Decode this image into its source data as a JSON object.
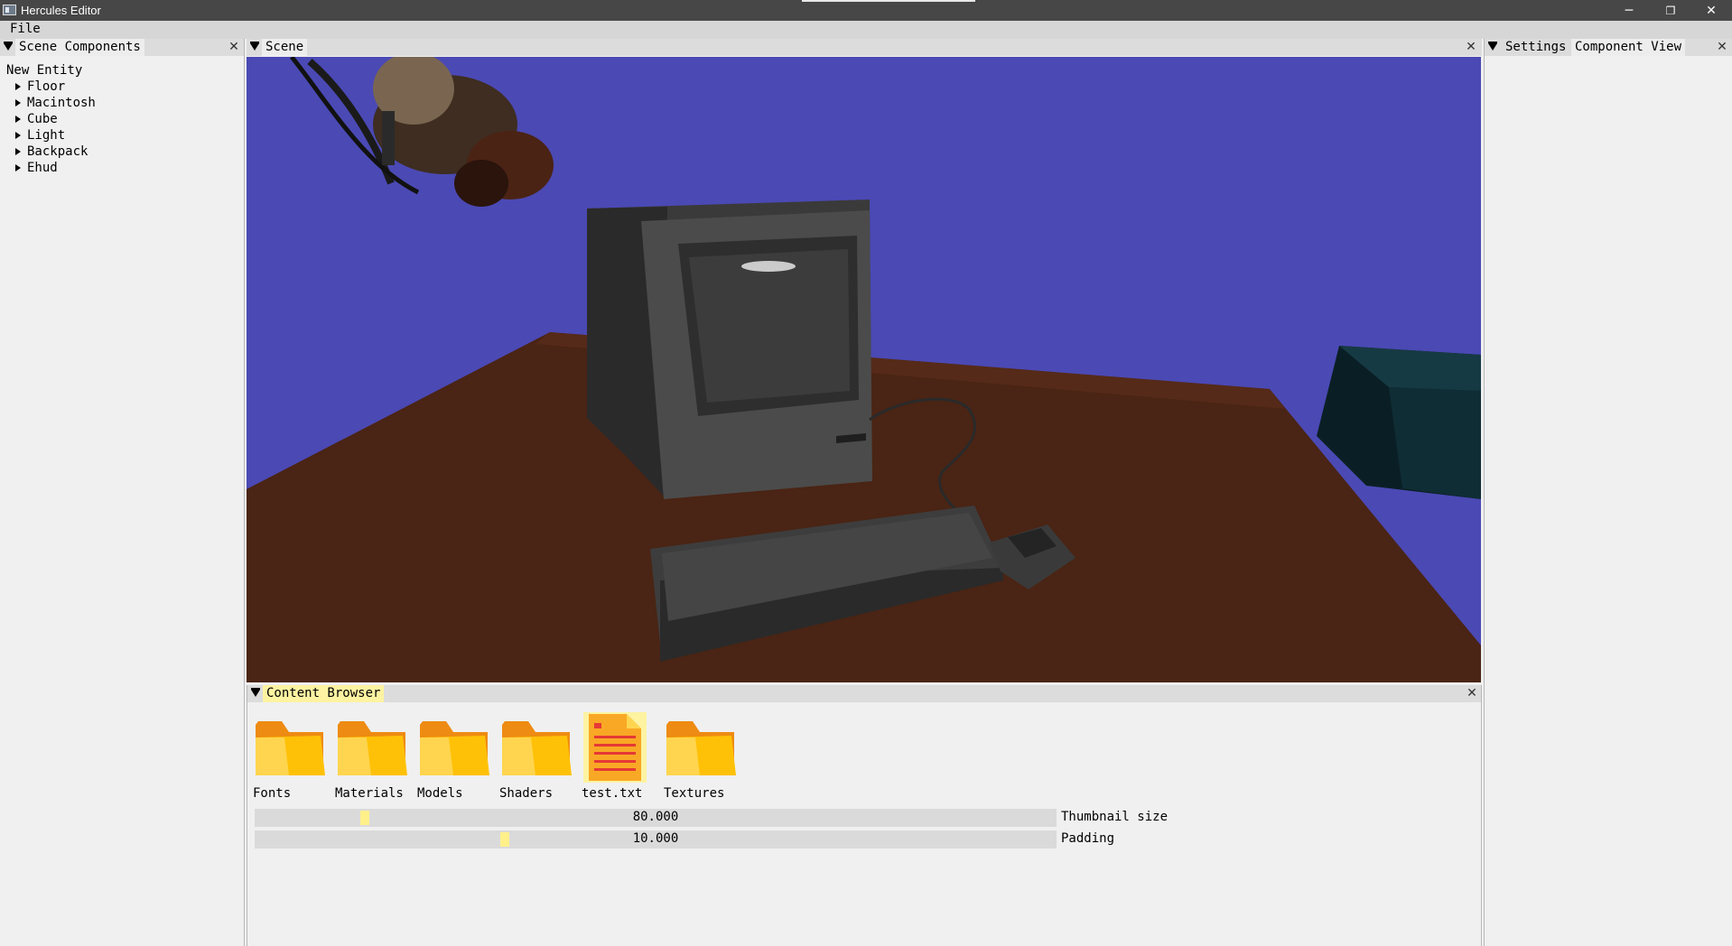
{
  "window": {
    "title": "Hercules Editor",
    "minimize_glyph": "─",
    "restore_glyph": "❐",
    "close_glyph": "✕"
  },
  "menubar": {
    "items": [
      {
        "label": "File"
      }
    ]
  },
  "scene_components": {
    "tab": "Scene Components",
    "close_glyph": "✕",
    "root": "New Entity",
    "entities": [
      {
        "label": "Floor"
      },
      {
        "label": "Macintosh"
      },
      {
        "label": "Cube"
      },
      {
        "label": "Light"
      },
      {
        "label": "Backpack"
      },
      {
        "label": "Ehud"
      }
    ]
  },
  "scene": {
    "tab": "Scene",
    "close_glyph": "✕",
    "colors": {
      "sky": "#4b49b4",
      "table": "#4a2414",
      "computer": "#4a4a4a",
      "cube": "#0f2d35"
    }
  },
  "right_panel": {
    "tabs": [
      {
        "label": "Settings"
      },
      {
        "label": "Component View"
      }
    ],
    "close_glyph": "✕"
  },
  "content_browser": {
    "tab": "Content Browser",
    "close_glyph": "✕",
    "items": [
      {
        "label": "Fonts",
        "icon": "folder-icon"
      },
      {
        "label": "Materials",
        "icon": "folder-icon"
      },
      {
        "label": "Models",
        "icon": "folder-icon"
      },
      {
        "label": "Shaders",
        "icon": "folder-icon"
      },
      {
        "label": "test.txt",
        "icon": "text-file-icon"
      },
      {
        "label": "Textures",
        "icon": "folder-icon"
      }
    ],
    "sliders": [
      {
        "label": "Thumbnail size",
        "value": "80.000",
        "fraction": 0.133
      },
      {
        "label": "Padding",
        "value": "10.000",
        "fraction": 0.31
      }
    ],
    "colors": {
      "folder_back": "#ee8b12",
      "folder_front": "#ffc107",
      "file_bg": "#f9a825",
      "accent": "#fdf3a1"
    }
  }
}
